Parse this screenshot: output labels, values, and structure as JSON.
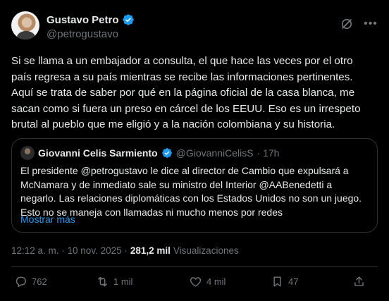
{
  "author": {
    "name": "Gustavo Petro",
    "handle": "@petrogustavo"
  },
  "tweet": {
    "text": "Si se llama a un embajador a consulta, el que hace las veces por el otro\npaís regresa a su país mientras se recibe las informaciones pertinentes.\nAquí se trata de saber por qué en la página oficial de la casa blanca, me\nsacan como si fuera un preso en cárcel de los EEUU. Eso es un irrespeto\nbrutal al pueblo que me eligió y a la nación colombiana y su historia."
  },
  "quote": {
    "name": "Giovanni Celis Sarmiento",
    "handle": "@GiovanniCelisS",
    "time": "· 17h",
    "text": "El presidente @petrogustavo le dice al director de Cambio que expulsará a\nMcNamara y de inmediato sale su ministro del Interior @AABenedetti a\nnegarlo. Las relaciones diplomáticas con los Estados Unidos no son un juego.\nEsto no se maneja con llamadas ni mucho menos por redes",
    "show_more": "Mostrar más"
  },
  "meta": {
    "timestamp": "12:12 a. m. · 10 nov. 2025 ·",
    "views_count": "281,2 mil",
    "views_label": "Visualizaciones"
  },
  "actions": {
    "replies": "762",
    "reposts": "1 mil",
    "likes": "4 mil",
    "bookmarks": "47"
  },
  "colors": {
    "background": "#000000",
    "text": "#e7e9ea",
    "secondary": "#71767b",
    "accent": "#1d9bf0",
    "border": "#2f3336"
  },
  "icons": [
    "verified-badge-icon",
    "grok-icon",
    "more-icon",
    "reply-icon",
    "repost-icon",
    "like-icon",
    "bookmark-icon",
    "share-icon"
  ]
}
